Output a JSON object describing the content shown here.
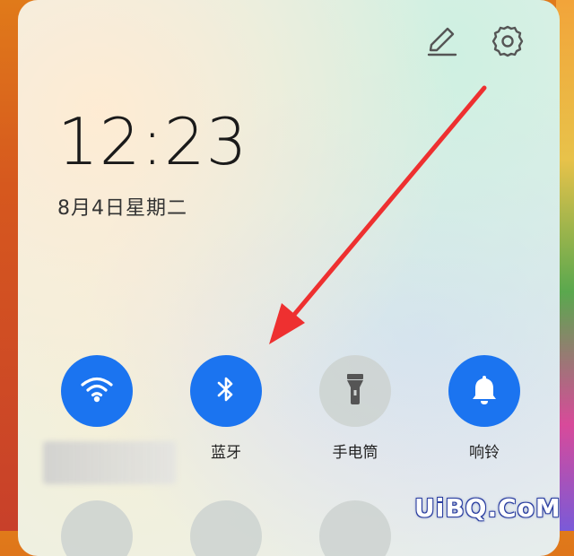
{
  "status": {
    "time": "12:23",
    "date": "8月4日星期二"
  },
  "header": {
    "edit_icon": "pencil-icon",
    "settings_icon": "gear-icon"
  },
  "toggles": [
    {
      "label": "",
      "icon": "wifi-icon",
      "state": "on"
    },
    {
      "label": "蓝牙",
      "icon": "bluetooth-icon",
      "state": "on"
    },
    {
      "label": "手电筒",
      "icon": "flashlight-icon",
      "state": "off"
    },
    {
      "label": "响铃",
      "icon": "bell-icon",
      "state": "on"
    }
  ],
  "watermark": "UiBQ.CoM",
  "colors": {
    "accent": "#1b74f0",
    "toggle_off": "#cdd2d0",
    "annotation_arrow": "#ee3030"
  }
}
